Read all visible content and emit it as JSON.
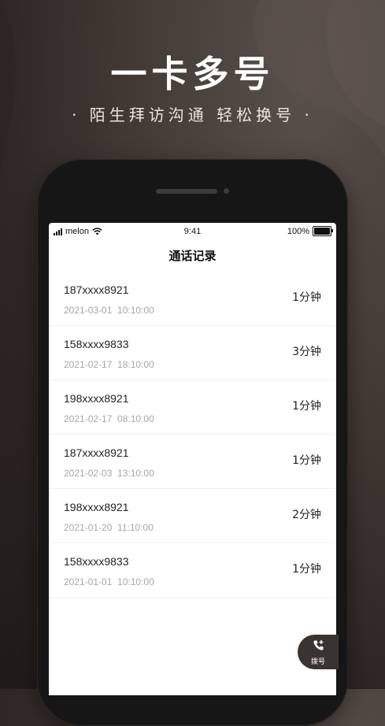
{
  "promo": {
    "headline": "一卡多号",
    "subline": "· 陌生拜访沟通  轻松换号 ·"
  },
  "status_bar": {
    "carrier": "melon",
    "time": "9:41",
    "battery": "100%",
    "icons": [
      "signal-icon",
      "wifi-icon",
      "battery-icon"
    ]
  },
  "screen_title": "通话记录",
  "calls": [
    {
      "number": "187xxxx8921",
      "datetime": "2021-03-01  10:10:00",
      "duration": "1分钟"
    },
    {
      "number": "158xxxx9833",
      "datetime": "2021-02-17  18:10:00",
      "duration": "3分钟"
    },
    {
      "number": "198xxxx8921",
      "datetime": "2021-02-17  08:10:00",
      "duration": "1分钟"
    },
    {
      "number": "187xxxx8921",
      "datetime": "2021-02-03  13:10:00",
      "duration": "1分钟"
    },
    {
      "number": "198xxxx8921",
      "datetime": "2021-01-20  11:10:00",
      "duration": "2分钟"
    },
    {
      "number": "158xxxx9833",
      "datetime": "2021-01-01  10:10:00",
      "duration": "1分钟"
    }
  ],
  "dial_button": {
    "label": "拨号",
    "icon": "phone-dial-icon"
  },
  "colors": {
    "background": "#3b3330",
    "device": "#161616",
    "screen": "#ffffff",
    "text_primary": "#222222",
    "text_secondary": "#a6a6a6",
    "fab": "#3a3431"
  }
}
